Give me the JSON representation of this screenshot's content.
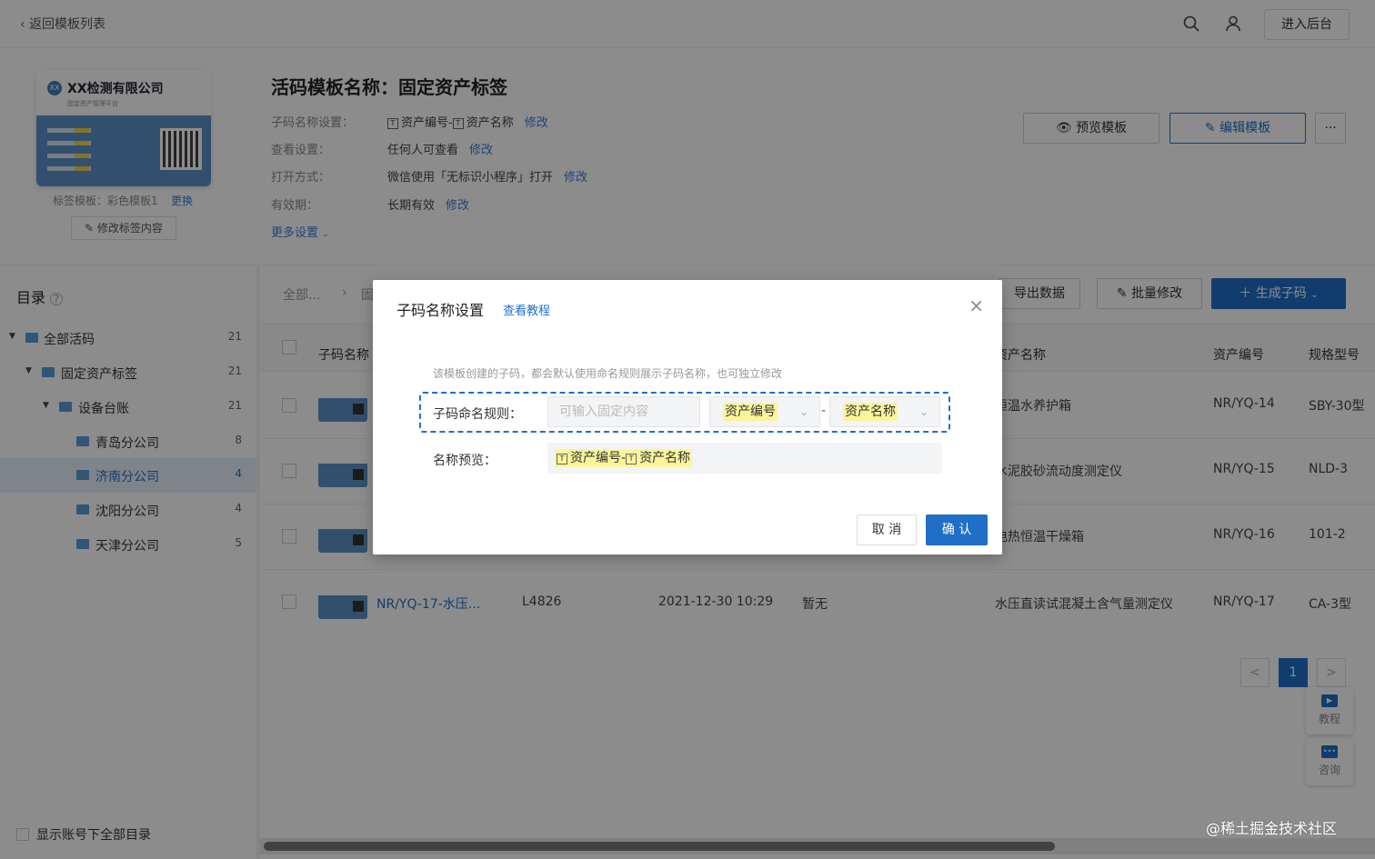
{
  "topbar": {
    "back_label": "返回模板列表",
    "admin_label": "进入后台"
  },
  "card": {
    "company": "XX检测有限公司",
    "sub": "固定资产管理平台",
    "logo": "XX"
  },
  "template": {
    "label_template_prefix": "标签模板：",
    "label_template_value": "彩色模板1",
    "change_link": "更换",
    "edit_label_btn": "修改标签内容",
    "title": "活码模板名称：固定资产标签",
    "rows": [
      {
        "k": "子码名称设置：",
        "v": "资产编号-",
        "v2": "资产名称",
        "m": "修改"
      },
      {
        "k": "查看设置：",
        "v": "任何人可查看",
        "m": "修改"
      },
      {
        "k": "打开方式：",
        "v": "微信使用「无标识小程序」打开",
        "m": "修改"
      },
      {
        "k": "有效期：",
        "v": "长期有效",
        "m": "修改"
      }
    ],
    "more_settings": "更多设置",
    "preview_btn": "预览模板",
    "edit_btn": "编辑模板",
    "more_btn": "···"
  },
  "sidebar": {
    "title": "目录",
    "items": [
      {
        "label": "全部活码",
        "count": "21"
      },
      {
        "label": "固定资产标签",
        "count": "21"
      },
      {
        "label": "设备台账",
        "count": "21"
      },
      {
        "label": "青岛分公司",
        "count": "8"
      },
      {
        "label": "济南分公司",
        "count": "4"
      },
      {
        "label": "沈阳分公司",
        "count": "4"
      },
      {
        "label": "天津分公司",
        "count": "5"
      }
    ],
    "show_all": "显示账号下全部目录"
  },
  "toolbar": {
    "crumb1": "全部...",
    "crumb2": "固",
    "export": "导出数据",
    "batch": "批量修改",
    "generate": "生成子码"
  },
  "table": {
    "headers": {
      "name": "子码名称",
      "asset_name": "资产名称",
      "asset_no": "资产编号",
      "model": "规格型号"
    },
    "rows": [
      {
        "asset_name": "恒温水养护箱",
        "asset_no": "NR/YQ-14",
        "model": "SBY-30型"
      },
      {
        "asset_name": "水泥胶砂流动度测定仪",
        "asset_no": "NR/YQ-15",
        "model": "NLD-3"
      },
      {
        "asset_name": "电热恒温干燥箱",
        "asset_no": "NR/YQ-16",
        "model": "101-2"
      },
      {
        "name": "NR/YQ-17-水压...",
        "code": "L4826",
        "time": "2021-12-30 10:29",
        "status": "暂无",
        "asset_name": "水压直读试混凝土含气量测定仪",
        "asset_no": "NR/YQ-17",
        "model": "CA-3型"
      }
    ]
  },
  "pagination": {
    "prev": "<",
    "current": "1",
    "next": ">"
  },
  "float": {
    "tutorial": "教程",
    "consult": "咨询"
  },
  "watermark": "@稀土掘金技术社区",
  "modal": {
    "title": "子码名称设置",
    "tutorial_link": "查看教程",
    "close": "×",
    "tip": "该模板创建的子码，都会默认使用命名规则展示子码名称，也可独立修改",
    "rule_label": "子码命名规则：",
    "fixed_placeholder": "可输入固定内容",
    "field1": "资产编号",
    "separator": "-",
    "field2": "资产名称",
    "preview_label": "名称预览：",
    "preview_part1": "资产编号-",
    "preview_part2": "资产名称",
    "cancel": "取 消",
    "confirm": "确 认"
  }
}
